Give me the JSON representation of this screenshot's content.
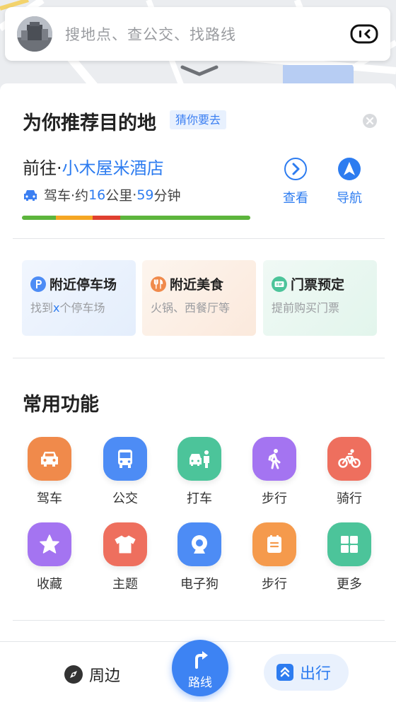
{
  "search": {
    "placeholder": "搜地点、查公交、找路线",
    "avatar_icon": "user-avatar-photo",
    "voice_icon": "voice-assistant-icon"
  },
  "recommend": {
    "title": "为你推荐目的地",
    "tag": "猜你要去",
    "dest_prefix": "前往·",
    "dest_name": "小木屋米酒店",
    "mode": "驾车",
    "sep1": "·约",
    "distance": "16",
    "distance_unit": "公里",
    "sep2": "·",
    "duration": "59",
    "duration_unit": "分钟",
    "view_label": "查看",
    "nav_label": "导航",
    "traffic": [
      {
        "status": "smooth",
        "color": "#5cb53c",
        "fraction": 0.15
      },
      {
        "status": "slow",
        "color": "#f5a623",
        "fraction": 0.16
      },
      {
        "status": "congested",
        "color": "#e0402f",
        "fraction": 0.12
      },
      {
        "status": "smooth",
        "color": "#5cb53c",
        "fraction": 0.57
      }
    ]
  },
  "cards": [
    {
      "title": "附近停车场",
      "subtitle_prefix": "找到",
      "subtitle_highlight": "x",
      "subtitle_suffix": "个停车场",
      "icon": "parking-icon"
    },
    {
      "title": "附近美食",
      "subtitle_prefix": "火锅、西餐厅等",
      "subtitle_highlight": "",
      "subtitle_suffix": "",
      "icon": "food-icon"
    },
    {
      "title": "门票预定",
      "subtitle_prefix": "提前购买门票",
      "subtitle_highlight": "",
      "subtitle_suffix": "",
      "icon": "ticket-icon"
    }
  ],
  "functions": {
    "title": "常用功能",
    "items": [
      {
        "label": "驾车",
        "icon": "car-icon",
        "color": "#f08a4b"
      },
      {
        "label": "公交",
        "icon": "bus-icon",
        "color": "#4d8cf5"
      },
      {
        "label": "打车",
        "icon": "taxi-icon",
        "color": "#4cc49a"
      },
      {
        "label": "步行",
        "icon": "walk-icon",
        "color": "#a474f1"
      },
      {
        "label": "骑行",
        "icon": "bike-icon",
        "color": "#ee6f5e"
      },
      {
        "label": "收藏",
        "icon": "star-icon",
        "color": "#a474f1"
      },
      {
        "label": "主题",
        "icon": "shirt-icon",
        "color": "#ee6f5e"
      },
      {
        "label": "电子狗",
        "icon": "camera-icon",
        "color": "#4d8cf5"
      },
      {
        "label": "步行",
        "icon": "clipboard-icon",
        "color": "#f59a4c"
      },
      {
        "label": "更多",
        "icon": "grid-icon",
        "color": "#4cc49a"
      }
    ]
  },
  "bottom_nav": {
    "nearby": "周边",
    "route": "路线",
    "travel": "出行"
  },
  "colors": {
    "accent": "#2d7cf0"
  }
}
